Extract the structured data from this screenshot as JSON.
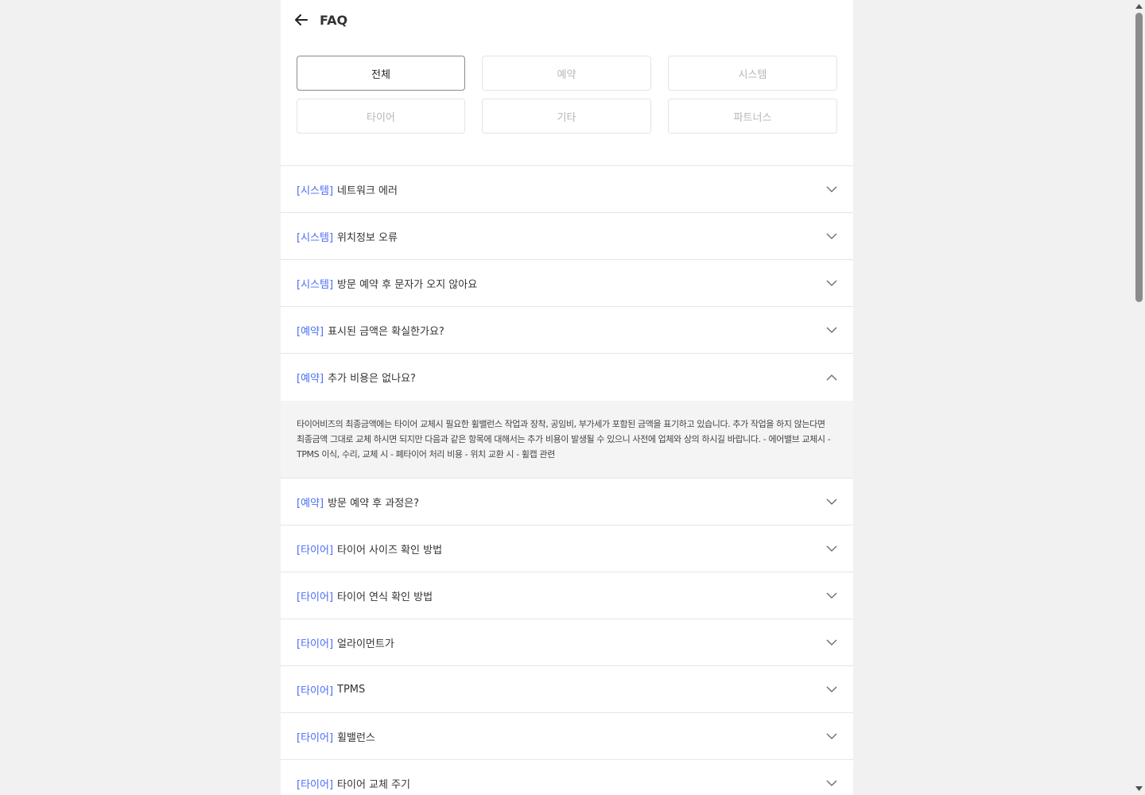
{
  "header": {
    "title": "FAQ"
  },
  "categories": [
    {
      "label": "전체",
      "active": true
    },
    {
      "label": "예약",
      "active": false
    },
    {
      "label": "시스템",
      "active": false
    },
    {
      "label": "타이어",
      "active": false
    },
    {
      "label": "기타",
      "active": false
    },
    {
      "label": "파트너스",
      "active": false
    }
  ],
  "faq": [
    {
      "tag": "[시스템]",
      "question": "네트워크 에러"
    },
    {
      "tag": "[시스템]",
      "question": "위치정보 오류"
    },
    {
      "tag": "[시스템]",
      "question": "방문 예약 후 문자가 오지 않아요"
    },
    {
      "tag": "[예약]",
      "question": "표시된 금액은 확실한가요?"
    },
    {
      "tag": "[예약]",
      "question": "추가 비용은 없나요?",
      "expanded": true,
      "answer": "타이어비즈의 최종금액에는 타이어 교체시 필요한 휠밸런스 작업과 장착, 공임비, 부가세가 포함된 금액을 표기하고 있습니다. 추가 작업을 하지 않는다면 최종금액 그대로 교체 하시면 되지만 다음과 같은 항목에 대해서는 추가 비용이 발생될 수 있으니 사전에 업체와 상의 하시길 바랍니다. - 에어밸브 교체시 - TPMS 이식, 수리, 교체 시 - 폐타이어 처리 비용 - 위치 교환 시 - 휠캡 관련"
    },
    {
      "tag": "[예약]",
      "question": "방문 예약 후 과정은?"
    },
    {
      "tag": "[타이어]",
      "question": "타이어 사이즈 확인 방법"
    },
    {
      "tag": "[타이어]",
      "question": "타이어 연식 확인 방법"
    },
    {
      "tag": "[타이어]",
      "question": "얼라이먼트가"
    },
    {
      "tag": "[타이어]",
      "question": "TPMS"
    },
    {
      "tag": "[타이어]",
      "question": "휠밸런스"
    },
    {
      "tag": "[타이어]",
      "question": "타이어 교체 주기"
    }
  ],
  "colors": {
    "accent": "#4a6cf7",
    "panel": "#f4f4f4"
  },
  "icons": {
    "back": "arrow-left-icon",
    "expand": "chevron-down-icon",
    "collapse": "chevron-up-icon"
  }
}
